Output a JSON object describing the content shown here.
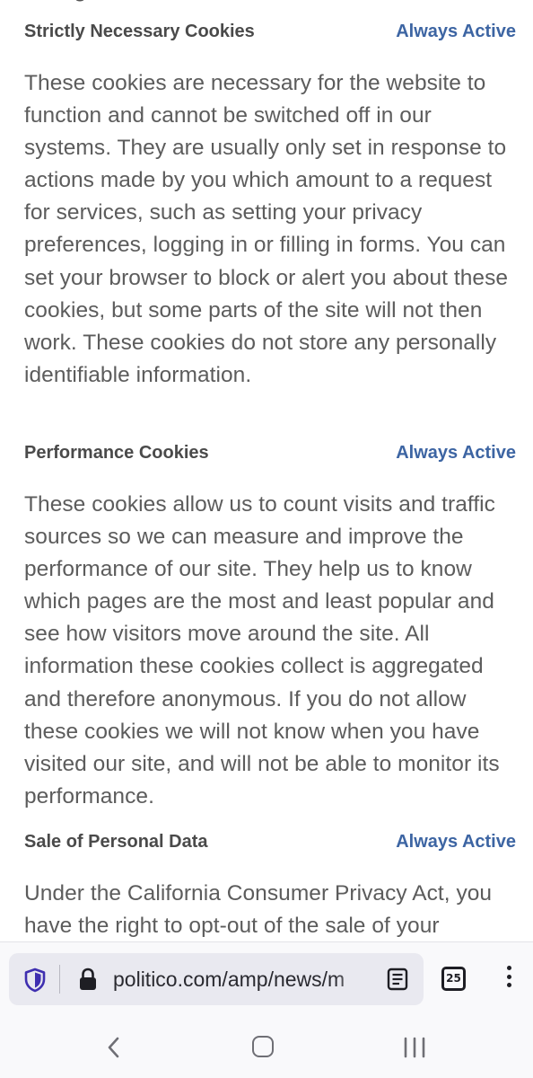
{
  "sections": [
    {
      "title": "Strictly Necessary Cookies",
      "status": "Always Active",
      "body": "These cookies are necessary for the website to function and cannot be switched off in our systems. They are usually only set in response to actions made by you which amount to a request for services, such as setting your privacy preferences, logging in or filling in forms. You can set your browser to block or alert you about these cookies, but some parts of the site will not then work. These cookies do not store any personally identifiable information."
    },
    {
      "title": "Performance Cookies",
      "status": "Always Active",
      "body": "These cookies allow us to count visits and traffic sources so we can measure and improve the performance of our site. They help us to know which pages are the most and least popular and see how visitors move around the site. All information these cookies collect is aggregated and therefore anonymous. If you do not allow these cookies we will not know when you have visited our site, and will not be able to monitor its performance."
    },
    {
      "title": "Sale of Personal Data",
      "status": "Always Active",
      "body": "Under the California Consumer Privacy Act, you have the right to opt-out of the sale of your personal information."
    }
  ],
  "browser": {
    "url": "politico.com/amp/news/m",
    "tab_count": "25"
  },
  "icons": {
    "shield": "tracking-protection-shield-icon",
    "lock": "lock-icon",
    "reader": "reader-view-icon",
    "tabs": "tab-counter-icon",
    "menu": "kebab-menu-icon",
    "back": "back-chevron-icon",
    "home": "home-icon",
    "recents": "recent-apps-icon"
  },
  "colors": {
    "accent": "#3d65a3",
    "body_text": "#5c5c5c",
    "heading_text": "#4a4a4a"
  }
}
